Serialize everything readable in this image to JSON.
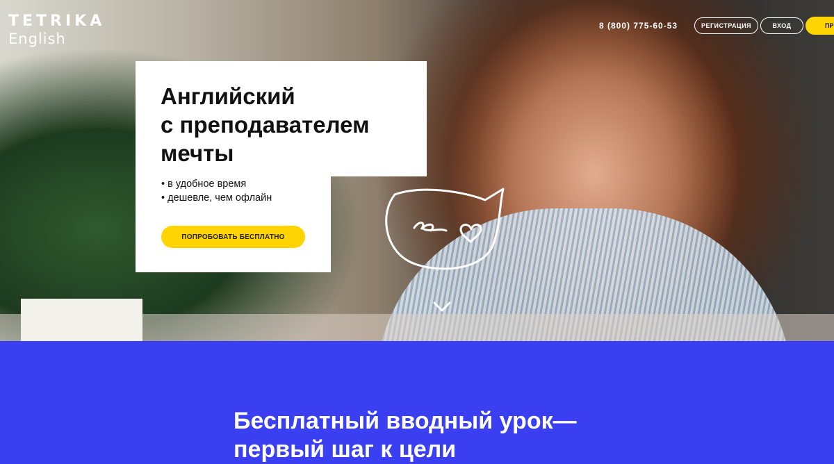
{
  "header": {
    "brand_top": "TETRIKA",
    "brand_bottom": "English",
    "phone": "8 (800) 775-60-53",
    "register_label": "РЕГИСТРАЦИЯ",
    "login_label": "ВХОД",
    "cut_button_label": "ПР"
  },
  "hero": {
    "title_lines": [
      "Английский",
      "с преподавателем",
      "мечты"
    ],
    "bullets": [
      "• в удобное время",
      "• дешевле, чем офлайн"
    ],
    "cta_label": "ПОПРОБОВАТЬ БЕСПЛАТНО"
  },
  "section": {
    "title_lines": [
      "Бесплатный вводный урок—",
      "первый шаг к цели"
    ]
  },
  "colors": {
    "accent_yellow": "#ffd400",
    "section_blue": "#3a3ff2"
  },
  "icons": [
    "speech-bubble-doodle-icon",
    "chevron-down-icon"
  ]
}
